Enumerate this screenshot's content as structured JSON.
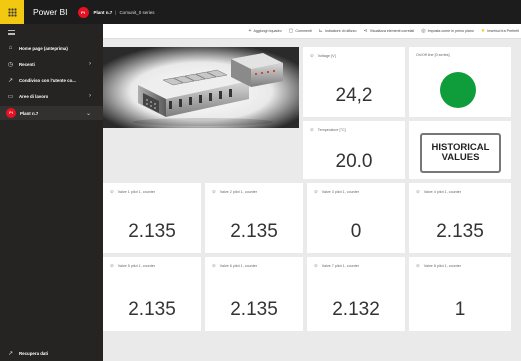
{
  "topbar": {
    "app_name": "Power BI",
    "workspace_initials": "Pl",
    "breadcrumb_workspace": "Plant n.7",
    "breadcrumb_separator": "|",
    "breadcrumb_dashboard": "Comunit_0 series",
    "accent_color": "#f2c811"
  },
  "sidebar": {
    "items": [
      {
        "icon": "home-icon",
        "label": "Home page (anteprima)",
        "chevron": ""
      },
      {
        "icon": "clock-icon",
        "label": "Recenti",
        "chevron": "›"
      },
      {
        "icon": "shared-icon",
        "label": "Condiviso con l'utente co...",
        "chevron": ""
      },
      {
        "icon": "workspaces-icon",
        "label": "Aree di lavoro",
        "chevron": "›"
      },
      {
        "icon": "workspace-avatar",
        "label": "Plant n.7",
        "chevron": "⌄",
        "initials": "Pl"
      }
    ],
    "get_data_label": "Recupera dati"
  },
  "actionbar": {
    "actions": [
      {
        "icon": "plus-icon",
        "label": "Aggiungi riquadro"
      },
      {
        "icon": "comment-icon",
        "label": "Commenti"
      },
      {
        "icon": "metrics-icon",
        "label": "Indicatore di utilizzo"
      },
      {
        "icon": "related-icon",
        "label": "Visualizza elementi correlati"
      },
      {
        "icon": "pin-icon",
        "label": "Imposta come in primo piano"
      },
      {
        "icon": "star-icon",
        "label": "Inserisci tra Preferiti"
      }
    ]
  },
  "tiles": {
    "voltage": {
      "title": "Voltage [V]",
      "value": "24,2"
    },
    "onoff": {
      "title": "On/Off line [0 series]",
      "status_color": "#0f9d3c"
    },
    "temperature": {
      "title": "Temperature [°C]",
      "value": "20.0"
    },
    "historical": {
      "line1": "HISTORICAL",
      "line2": "VALUES"
    },
    "valves": [
      {
        "title": "Valve 1 pilot 1, counter",
        "value": "2.135"
      },
      {
        "title": "Valve 2 pilot 1, counter",
        "value": "2.135"
      },
      {
        "title": "Valve 3 pilot 1, counter",
        "value": "0"
      },
      {
        "title": "Valve 4 pilot 1, counter",
        "value": "2.135"
      },
      {
        "title": "Valve 5 pilot 1, counter",
        "value": "2.135"
      },
      {
        "title": "Valve 6 pilot 1, counter",
        "value": "2.135"
      },
      {
        "title": "Valve 7 pilot 1, counter",
        "value": "2.132"
      },
      {
        "title": "Valve 8 pilot 1, counter",
        "value": "1"
      }
    ]
  }
}
